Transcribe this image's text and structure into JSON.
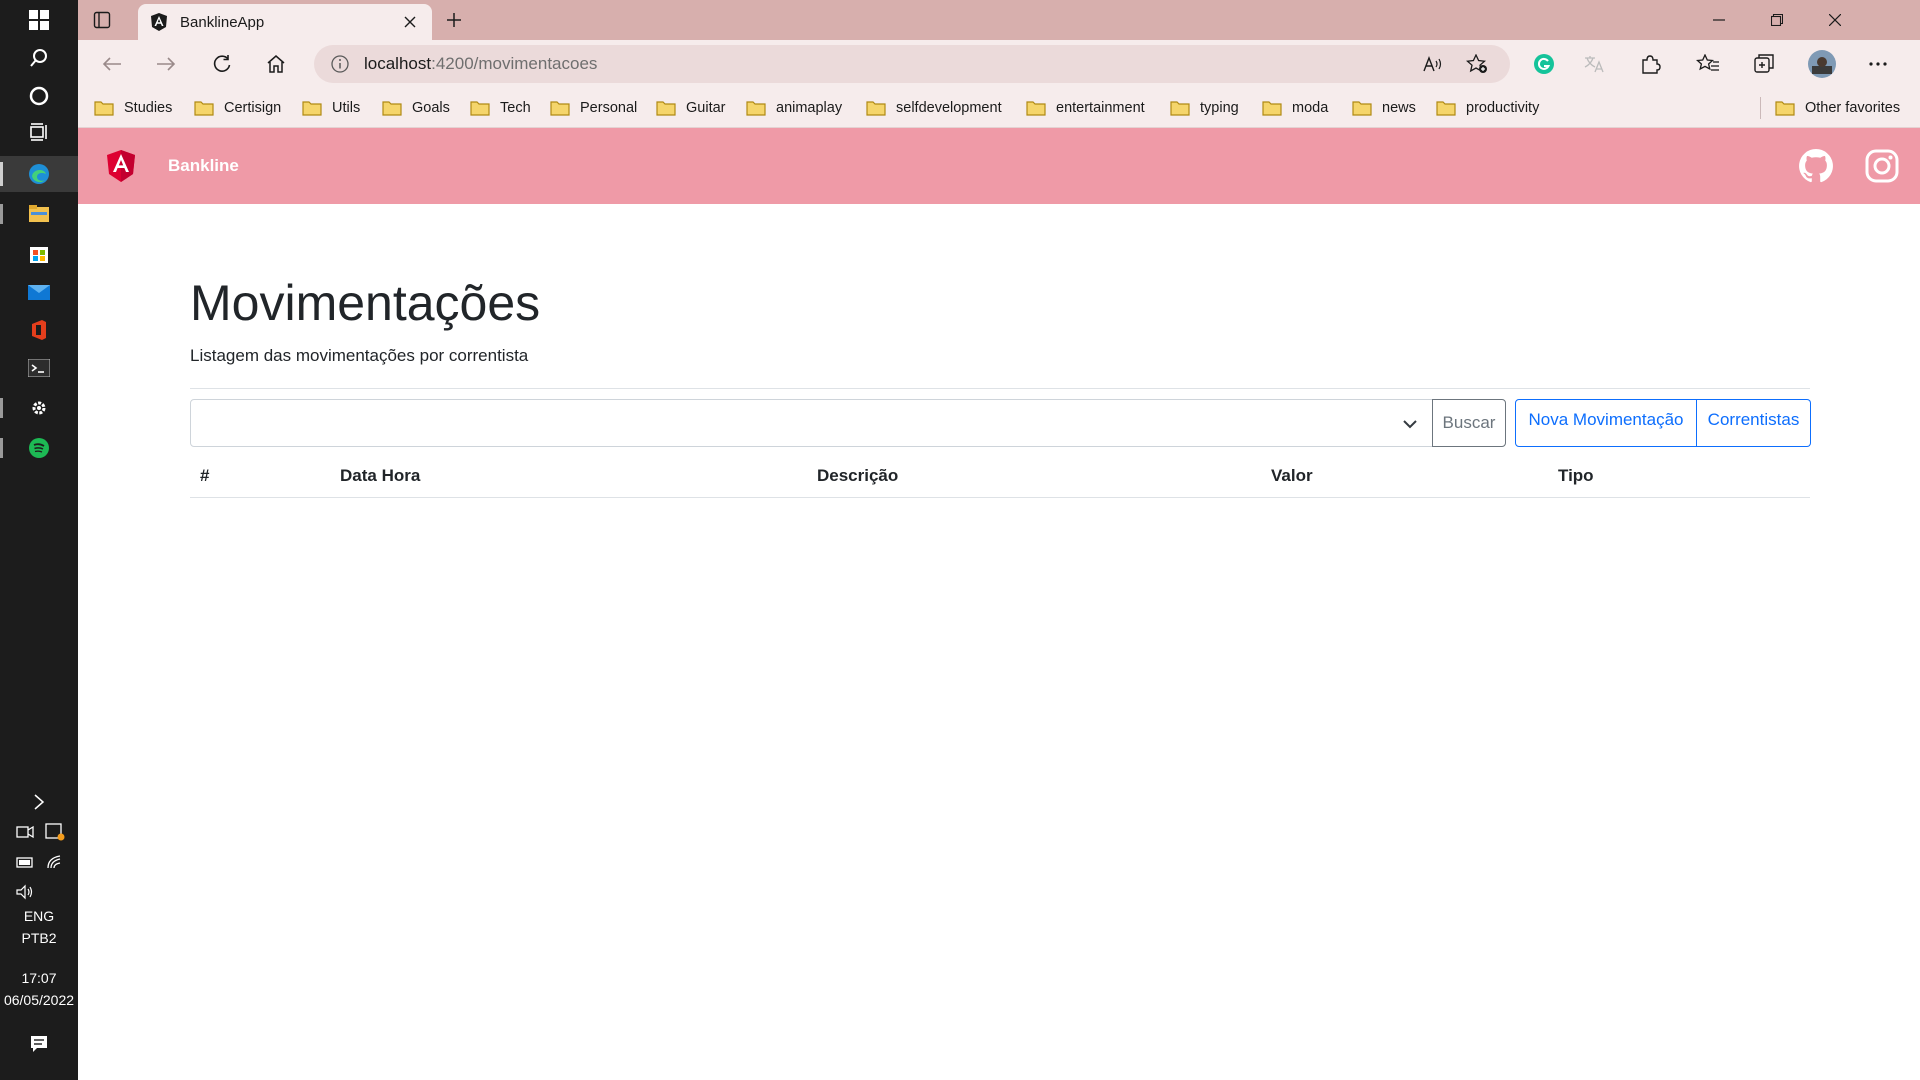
{
  "taskbar": {
    "icons": [
      "windows-start-icon",
      "search-icon",
      "cortana-icon",
      "task-view-icon",
      "edge-icon",
      "file-explorer-icon",
      "store-icon",
      "mail-icon",
      "office-icon",
      "terminal-icon",
      "settings-icon",
      "spotify-icon"
    ],
    "tray": {
      "language": "ENG",
      "layout": "PTB2",
      "time": "17:07",
      "date": "06/05/2022"
    }
  },
  "browser": {
    "tab": {
      "title": "BanklineApp"
    },
    "address": {
      "host": "localhost",
      "rest": ":4200/movimentacoes"
    },
    "favorites": [
      "Studies",
      "Certisign",
      "Utils",
      "Goals",
      "Tech",
      "Personal",
      "Guitar",
      "animaplay",
      "selfdevelopment",
      "entertainment",
      "typing",
      "moda",
      "news",
      "productivity"
    ],
    "other_favorites": "Other favorites"
  },
  "app": {
    "brand": "Bankline",
    "page": {
      "title": "Movimentações",
      "subtitle": "Listagem das movimentações por correntista"
    },
    "filter": {
      "select_value": "",
      "buscar_label": "Buscar",
      "nova_label": "Nova Movimentação",
      "correntistas_label": "Correntistas"
    },
    "table": {
      "columns": [
        "#",
        "Data Hora",
        "Descrição",
        "Valor",
        "Tipo"
      ],
      "rows": []
    }
  },
  "colors": {
    "navbar": "#ef9aa7",
    "titlebar": "#d7afad",
    "toolbar": "#f6ecec",
    "primary": "#0d6efd",
    "secondary": "#6c757d"
  }
}
